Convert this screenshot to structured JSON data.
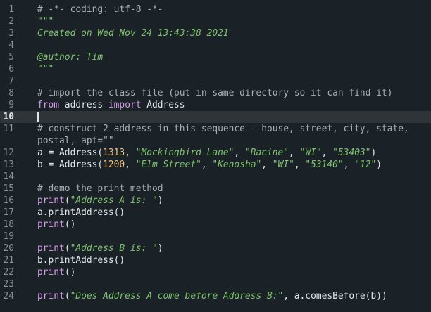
{
  "editor": {
    "current_line": 10,
    "lines": [
      {
        "n": "1",
        "segs": [
          {
            "c": "cm",
            "t": "# -*- coding: utf-8 -*-"
          }
        ]
      },
      {
        "n": "2",
        "segs": [
          {
            "c": "doc",
            "t": "\"\"\""
          }
        ]
      },
      {
        "n": "3",
        "segs": [
          {
            "c": "doc",
            "t": "Created on Wed Nov 24 13:43:38 2021"
          }
        ]
      },
      {
        "n": "4",
        "segs": []
      },
      {
        "n": "5",
        "segs": [
          {
            "c": "doc",
            "t": "@author: Tim"
          }
        ]
      },
      {
        "n": "6",
        "segs": [
          {
            "c": "doc",
            "t": "\"\"\""
          }
        ]
      },
      {
        "n": "7",
        "segs": []
      },
      {
        "n": "8",
        "segs": [
          {
            "c": "cm",
            "t": "# import the class file (put in same directory so it can find it)"
          }
        ]
      },
      {
        "n": "9",
        "segs": [
          {
            "c": "kw",
            "t": "from"
          },
          {
            "c": "plain",
            "t": " address "
          },
          {
            "c": "kw",
            "t": "import"
          },
          {
            "c": "plain",
            "t": " Address"
          }
        ]
      },
      {
        "n": "10",
        "segs": []
      },
      {
        "n": "11",
        "segs": [
          {
            "c": "cm",
            "t": "# construct 2 address in this sequence - house, street, city, state,"
          }
        ]
      },
      {
        "n": "",
        "segs": [
          {
            "c": "cm",
            "t": "postal, apt=\"\""
          }
        ]
      },
      {
        "n": "12",
        "segs": [
          {
            "c": "plain",
            "t": "a = Address("
          },
          {
            "c": "num",
            "t": "1313"
          },
          {
            "c": "plain",
            "t": ", "
          },
          {
            "c": "str",
            "t": "\"Mockingbird Lane\""
          },
          {
            "c": "plain",
            "t": ", "
          },
          {
            "c": "str",
            "t": "\"Racine\""
          },
          {
            "c": "plain",
            "t": ", "
          },
          {
            "c": "str",
            "t": "\"WI\""
          },
          {
            "c": "plain",
            "t": ", "
          },
          {
            "c": "str",
            "t": "\"53403\""
          },
          {
            "c": "plain",
            "t": ")"
          }
        ]
      },
      {
        "n": "13",
        "segs": [
          {
            "c": "plain",
            "t": "b = Address("
          },
          {
            "c": "num",
            "t": "1200"
          },
          {
            "c": "plain",
            "t": ", "
          },
          {
            "c": "str",
            "t": "\"Elm Street\""
          },
          {
            "c": "plain",
            "t": ", "
          },
          {
            "c": "str",
            "t": "\"Kenosha\""
          },
          {
            "c": "plain",
            "t": ", "
          },
          {
            "c": "str",
            "t": "\"WI\""
          },
          {
            "c": "plain",
            "t": ", "
          },
          {
            "c": "str",
            "t": "\"53140\""
          },
          {
            "c": "plain",
            "t": ", "
          },
          {
            "c": "str",
            "t": "\"12\""
          },
          {
            "c": "plain",
            "t": ")"
          }
        ]
      },
      {
        "n": "14",
        "segs": []
      },
      {
        "n": "15",
        "segs": [
          {
            "c": "cm",
            "t": "# demo the print method"
          }
        ]
      },
      {
        "n": "16",
        "segs": [
          {
            "c": "fn",
            "t": "print"
          },
          {
            "c": "plain",
            "t": "("
          },
          {
            "c": "str",
            "t": "\"Address A is: \""
          },
          {
            "c": "plain",
            "t": ")"
          }
        ]
      },
      {
        "n": "17",
        "segs": [
          {
            "c": "plain",
            "t": "a.printAddress()"
          }
        ]
      },
      {
        "n": "18",
        "segs": [
          {
            "c": "fn",
            "t": "print"
          },
          {
            "c": "plain",
            "t": "()"
          }
        ]
      },
      {
        "n": "19",
        "segs": []
      },
      {
        "n": "20",
        "segs": [
          {
            "c": "fn",
            "t": "print"
          },
          {
            "c": "plain",
            "t": "("
          },
          {
            "c": "str",
            "t": "\"Address B is: \""
          },
          {
            "c": "plain",
            "t": ")"
          }
        ]
      },
      {
        "n": "21",
        "segs": [
          {
            "c": "plain",
            "t": "b.printAddress()"
          }
        ]
      },
      {
        "n": "22",
        "segs": [
          {
            "c": "fn",
            "t": "print"
          },
          {
            "c": "plain",
            "t": "()"
          }
        ]
      },
      {
        "n": "23",
        "segs": []
      },
      {
        "n": "24",
        "segs": [
          {
            "c": "fn",
            "t": "print"
          },
          {
            "c": "plain",
            "t": "("
          },
          {
            "c": "str",
            "t": "\"Does Address A come before Address B:\""
          },
          {
            "c": "plain",
            "t": ", a.comesBefore(b))"
          }
        ]
      }
    ]
  }
}
